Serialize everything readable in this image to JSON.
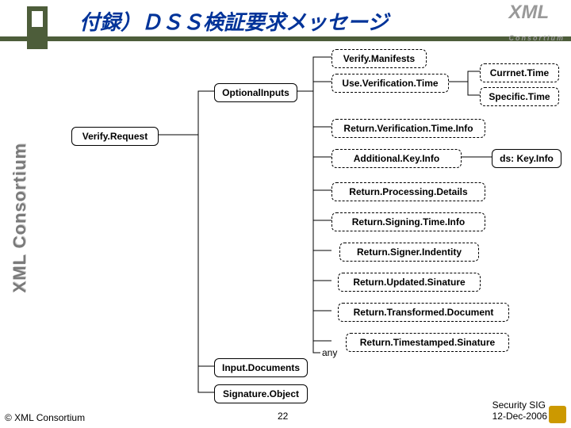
{
  "header": {
    "title": "付録）ＤＳＳ検証要求メッセージ",
    "logo": "XML",
    "logo_sub": "Consortium"
  },
  "sidebar": {
    "text": "XML Consortium"
  },
  "boxes": {
    "verify_request": "Verify.Request",
    "optional_inputs": "OptionalInputs",
    "input_documents": "Input.Documents",
    "signature_object": "Signature.Object",
    "verify_manifests": "Verify.Manifests",
    "use_verification_time": "Use.Verification.Time",
    "current_time": "Currnet.Time",
    "specific_time": "Specific.Time",
    "return_verification_time_info": "Return.Verification.Time.Info",
    "additional_key_info": "Additional.Key.Info",
    "ds_key_info": "ds: Key.Info",
    "return_processing_details": "Return.Processing.Details",
    "return_signing_time_info": "Return.Signing.Time.Info",
    "return_signer_identity": "Return.Signer.Indentity",
    "return_updated_signature": "Return.Updated.Sinature",
    "return_transformed_document": "Return.Transformed.Document",
    "return_timestamped_signature": "Return.Timestamped.Sinature",
    "any_label": "any"
  },
  "footer": {
    "left": "© XML Consortium",
    "page": "22",
    "right_line1": "Security SIG",
    "right_line2": "12-Dec-2006"
  }
}
